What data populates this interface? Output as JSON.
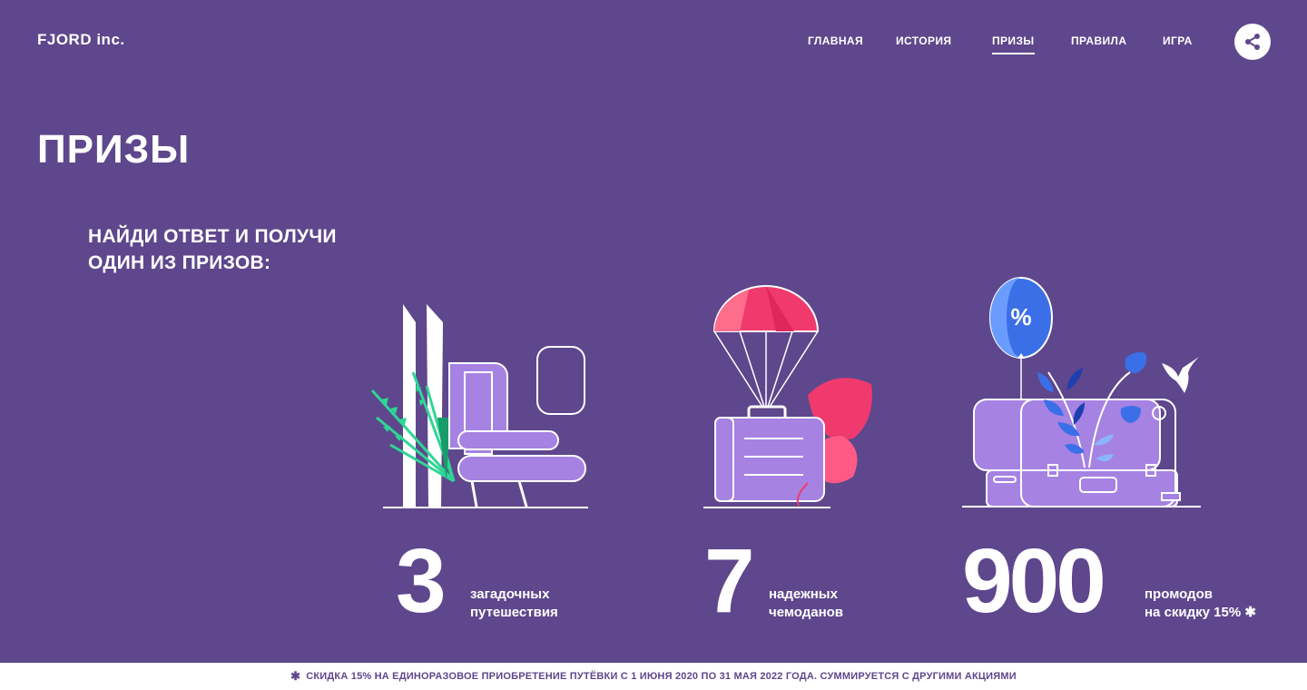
{
  "header": {
    "logo": "FJORD inc.",
    "nav": [
      {
        "label": "ГЛАВНАЯ",
        "active": false
      },
      {
        "label": "ИСТОРИЯ",
        "active": false
      },
      {
        "label": "ПРИЗЫ",
        "active": true
      },
      {
        "label": "ПРАВИЛА",
        "active": false
      },
      {
        "label": "ИГРА",
        "active": false
      }
    ],
    "share_icon": "share-icon"
  },
  "main": {
    "title": "ПРИЗЫ",
    "subtitle_line1": "НАЙДИ ОТВЕТ И ПОЛУЧИ",
    "subtitle_line2": "ОДИН ИЗ ПРИЗОВ:",
    "prizes": [
      {
        "number": "3",
        "line1": "загадочных",
        "line2": "путешествия",
        "icon": "airplane-seat-icon"
      },
      {
        "number": "7",
        "line1": "надежных",
        "line2": "чемоданов",
        "icon": "parachute-suitcase-icon"
      },
      {
        "number": "900",
        "line1": "промодов",
        "line2": "на скидку 15%",
        "asterisk": "✱",
        "icon": "balloon-suitcase-icon"
      }
    ]
  },
  "footer": {
    "star": "✱",
    "text": "СКИДКА 15% НА ЕДИНОРАЗОВОЕ ПРИОБРЕТЕНИЕ ПУТЁВКИ С 1 ИЮНЯ 2020 ПО 31 МАЯ 2022 ГОДА. СУММИРУЕТСЯ С ДРУГИМИ АКЦИЯМИ"
  },
  "colors": {
    "background": "#5e478c",
    "illustration_purple": "#a682e3",
    "accent_pink": "#f03a6e",
    "accent_blue": "#3b6fe8",
    "accent_green": "#2fd596"
  }
}
